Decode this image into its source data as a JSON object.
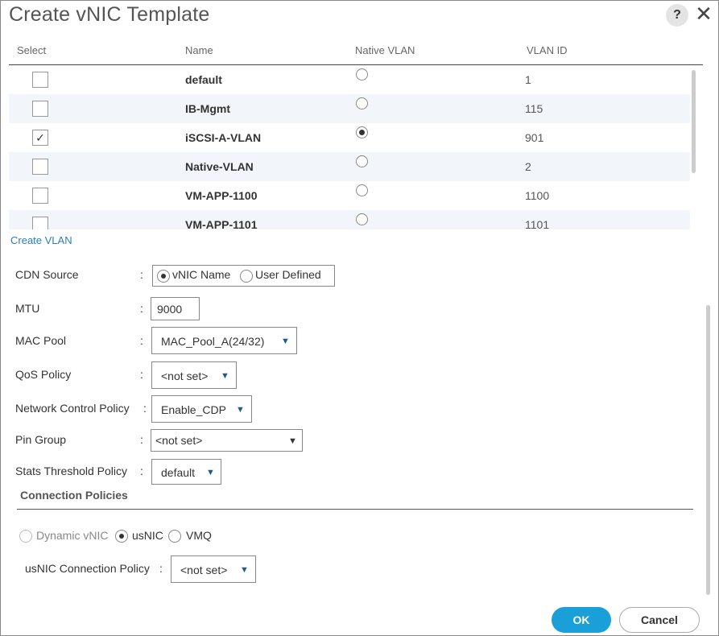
{
  "dialog": {
    "title": "Create vNIC Template",
    "help": "?",
    "close": "✕"
  },
  "vlan_table": {
    "headers": {
      "select": "Select",
      "name": "Name",
      "native": "Native VLAN",
      "vlan_id": "VLAN ID"
    },
    "rows": [
      {
        "checked": false,
        "check_mark": "",
        "name": "default",
        "native": false,
        "id": "1"
      },
      {
        "checked": false,
        "check_mark": "",
        "name": "IB-Mgmt",
        "native": false,
        "id": "115"
      },
      {
        "checked": true,
        "check_mark": "✓",
        "name": "iSCSI-A-VLAN",
        "native": true,
        "id": "901"
      },
      {
        "checked": false,
        "check_mark": "",
        "name": "Native-VLAN",
        "native": false,
        "id": "2"
      },
      {
        "checked": false,
        "check_mark": "",
        "name": "VM-APP-1100",
        "native": false,
        "id": "1100"
      },
      {
        "checked": false,
        "check_mark": "",
        "name": "VM-APP-1101",
        "native": false,
        "id": "1101"
      }
    ]
  },
  "create_vlan": "Create VLAN",
  "form": {
    "cdn_source": {
      "label": "CDN Source",
      "colon": ":",
      "opt1": "vNIC Name",
      "opt2": "User Defined",
      "selected": "vNIC Name"
    },
    "mtu": {
      "label": "MTU",
      "colon": ":",
      "value": "9000"
    },
    "mac_pool": {
      "label": "MAC Pool",
      "colon": ":",
      "value": "MAC_Pool_A(24/32)"
    },
    "qos_policy": {
      "label": "QoS Policy",
      "colon": ":",
      "value": "<not set>"
    },
    "network_control_policy": {
      "label": "Network Control Policy",
      "colon": ":",
      "value": "Enable_CDP"
    },
    "pin_group": {
      "label": "Pin Group",
      "colon": ":",
      "value": "<not set>"
    },
    "stats_threshold_policy": {
      "label": "Stats Threshold Policy",
      "colon": ":",
      "value": "default"
    }
  },
  "connection_policies": {
    "title": "Connection Policies",
    "opt1": "Dynamic vNIC",
    "opt2": "usNIC",
    "opt3": "VMQ",
    "selected": "usNIC",
    "usnic_label": "usNIC Connection Policy",
    "usnic_colon": ":",
    "usnic_value": "<not set>"
  },
  "buttons": {
    "ok": "OK",
    "cancel": "Cancel"
  },
  "icons": {
    "caret": "▼",
    "colors": {
      "accent": "#1a9fd8",
      "link": "#2b7db8",
      "caret": "#1f5b8d"
    }
  }
}
